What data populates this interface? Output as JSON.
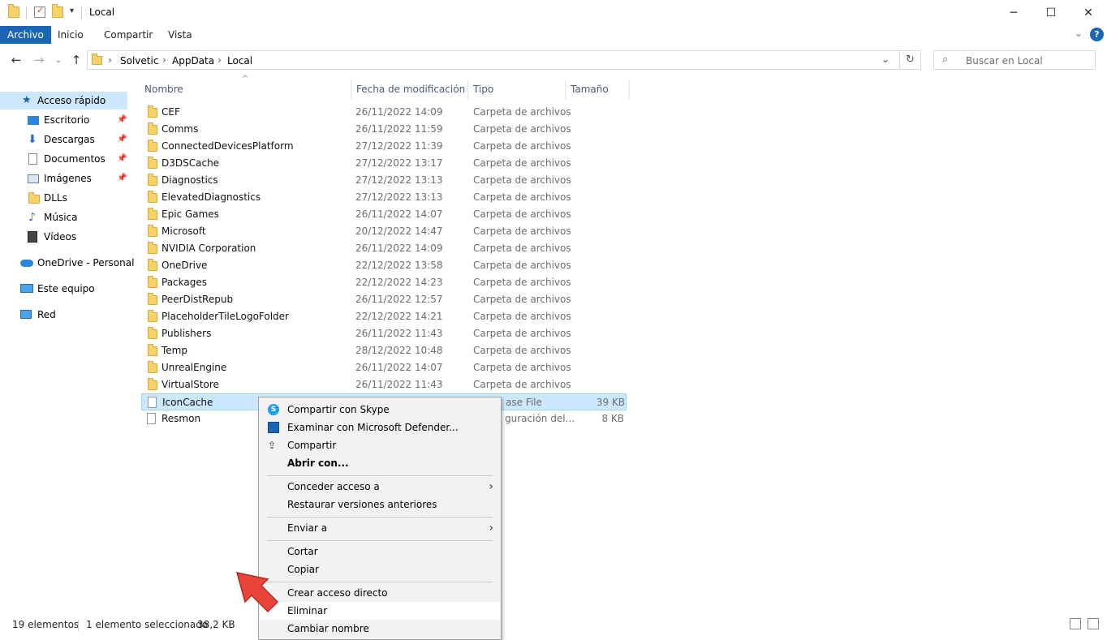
{
  "window": {
    "title": "Local",
    "minimize_glyph": "─",
    "maximize_glyph": "☐",
    "close_glyph": "✕"
  },
  "ribbon": {
    "tabs": [
      "Archivo",
      "Inicio",
      "Compartir",
      "Vista"
    ],
    "help_glyph": "?",
    "expand_glyph": "⌄"
  },
  "address": {
    "crumbs": [
      "Solvetic",
      "AppData",
      "Local"
    ],
    "separator": "›",
    "search_placeholder": "Buscar en Local"
  },
  "nav": {
    "quick_access": "Acceso rápido",
    "items": [
      {
        "label": "Escritorio",
        "icon": "desktop-icon",
        "pinned": true
      },
      {
        "label": "Descargas",
        "icon": "download-icon",
        "pinned": true
      },
      {
        "label": "Documentos",
        "icon": "documents-icon",
        "pinned": true
      },
      {
        "label": "Imágenes",
        "icon": "pictures-icon",
        "pinned": true
      },
      {
        "label": "DLLs",
        "icon": "folder-icon",
        "pinned": false
      },
      {
        "label": "Música",
        "icon": "music-icon",
        "pinned": false
      },
      {
        "label": "Vídeos",
        "icon": "videos-icon",
        "pinned": false
      }
    ],
    "onedrive": "OneDrive - Personal",
    "this_pc": "Este equipo",
    "network": "Red"
  },
  "columns": {
    "name": "Nombre",
    "date": "Fecha de modificación",
    "type": "Tipo",
    "size": "Tamaño"
  },
  "files": [
    {
      "name": "CEF",
      "date": "26/11/2022 14:09",
      "type": "Carpeta de archivos",
      "size": ""
    },
    {
      "name": "Comms",
      "date": "26/11/2022 11:59",
      "type": "Carpeta de archivos",
      "size": ""
    },
    {
      "name": "ConnectedDevicesPlatform",
      "date": "27/12/2022 11:39",
      "type": "Carpeta de archivos",
      "size": ""
    },
    {
      "name": "D3DSCache",
      "date": "27/12/2022 13:17",
      "type": "Carpeta de archivos",
      "size": ""
    },
    {
      "name": "Diagnostics",
      "date": "27/12/2022 13:13",
      "type": "Carpeta de archivos",
      "size": ""
    },
    {
      "name": "ElevatedDiagnostics",
      "date": "27/12/2022 13:13",
      "type": "Carpeta de archivos",
      "size": ""
    },
    {
      "name": "Epic Games",
      "date": "26/11/2022 14:07",
      "type": "Carpeta de archivos",
      "size": ""
    },
    {
      "name": "Microsoft",
      "date": "20/12/2022 14:47",
      "type": "Carpeta de archivos",
      "size": ""
    },
    {
      "name": "NVIDIA Corporation",
      "date": "26/11/2022 14:09",
      "type": "Carpeta de archivos",
      "size": ""
    },
    {
      "name": "OneDrive",
      "date": "22/12/2022 13:58",
      "type": "Carpeta de archivos",
      "size": ""
    },
    {
      "name": "Packages",
      "date": "22/12/2022 14:23",
      "type": "Carpeta de archivos",
      "size": ""
    },
    {
      "name": "PeerDistRepub",
      "date": "26/11/2022 12:57",
      "type": "Carpeta de archivos",
      "size": ""
    },
    {
      "name": "PlaceholderTileLogoFolder",
      "date": "22/12/2022 14:21",
      "type": "Carpeta de archivos",
      "size": ""
    },
    {
      "name": "Publishers",
      "date": "26/11/2022 11:43",
      "type": "Carpeta de archivos",
      "size": ""
    },
    {
      "name": "Temp",
      "date": "28/12/2022 10:48",
      "type": "Carpeta de archivos",
      "size": ""
    },
    {
      "name": "UnrealEngine",
      "date": "26/11/2022 14:07",
      "type": "Carpeta de archivos",
      "size": ""
    },
    {
      "name": "VirtualStore",
      "date": "26/11/2022 11:43",
      "type": "Carpeta de archivos",
      "size": ""
    },
    {
      "name": "IconCache",
      "date": "",
      "type": "ase File",
      "size": "39 KB",
      "selected": true
    },
    {
      "name": "Resmon",
      "date": "",
      "type": "guración del...",
      "size": "8 KB"
    }
  ],
  "context_menu": {
    "skype": "Compartir con Skype",
    "defender": "Examinar con Microsoft Defender...",
    "share": "Compartir",
    "open_with": "Abrir con...",
    "give_access": "Conceder acceso a",
    "restore": "Restaurar versiones anteriores",
    "send_to": "Enviar a",
    "cut": "Cortar",
    "copy": "Copiar",
    "shortcut": "Crear acceso directo",
    "delete": "Eliminar",
    "rename": "Cambiar nombre"
  },
  "status": {
    "count": "19 elementos",
    "selection": "1 elemento seleccionado",
    "size": "38,2 KB"
  },
  "colors": {
    "accent": "#1a65b5",
    "selection_bg": "#cce8ff",
    "folder": "#f7d26a",
    "arrow": "#e8443a"
  }
}
